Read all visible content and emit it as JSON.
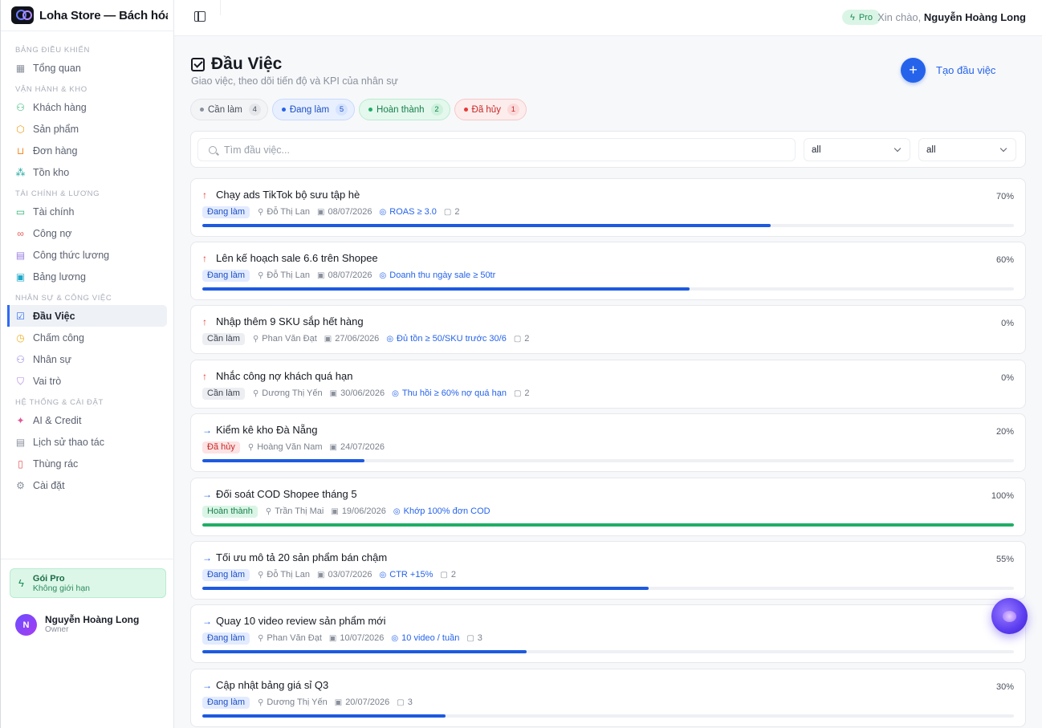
{
  "brand": {
    "title": "Loha Store — Bách hóa ..."
  },
  "sidebar": {
    "sections": [
      {
        "label": "BẢNG ĐIỀU KHIỂN",
        "items": [
          {
            "label": "Tổng quan",
            "icon": "grid-icon",
            "color": "#8a909c"
          }
        ]
      },
      {
        "label": "VẬN HÀNH & KHO",
        "items": [
          {
            "label": "Khách hàng",
            "icon": "users-icon",
            "color": "#2bb673"
          },
          {
            "label": "Sản phẩm",
            "icon": "box-icon",
            "color": "#f0a020"
          },
          {
            "label": "Đơn hàng",
            "icon": "cart-icon",
            "color": "#f08a20"
          },
          {
            "label": "Tồn kho",
            "icon": "boxes-icon",
            "color": "#20a8a0"
          }
        ]
      },
      {
        "label": "TÀI CHÍNH & LƯƠNG",
        "items": [
          {
            "label": "Tài chính",
            "icon": "wallet-icon",
            "color": "#2bb673"
          },
          {
            "label": "Công nợ",
            "icon": "handshake-icon",
            "color": "#e25a5a"
          },
          {
            "label": "Công thức lương",
            "icon": "calculator-icon",
            "color": "#9a7de0"
          },
          {
            "label": "Bảng lương",
            "icon": "card-icon",
            "color": "#20a8c8"
          }
        ]
      },
      {
        "label": "NHÂN SỰ & CÔNG VIỆC",
        "items": [
          {
            "label": "Đầu Việc",
            "icon": "checkbox-icon",
            "color": "#2f6bf5",
            "active": true
          },
          {
            "label": "Chấm công",
            "icon": "clock-icon",
            "color": "#f0b020"
          },
          {
            "label": "Nhân sự",
            "icon": "user-group-icon",
            "color": "#8a7de0"
          },
          {
            "label": "Vai trò",
            "icon": "shield-icon",
            "color": "#b07de0"
          }
        ]
      },
      {
        "label": "HỆ THỐNG & CÀI ĐẶT",
        "items": [
          {
            "label": "AI & Credit",
            "icon": "sparkles-icon",
            "color": "#e05a9a"
          },
          {
            "label": "Lịch sử thao tác",
            "icon": "history-icon",
            "color": "#8a909c"
          },
          {
            "label": "Thùng rác",
            "icon": "trash-icon",
            "color": "#e25a5a"
          },
          {
            "label": "Cài đặt",
            "icon": "gear-icon",
            "color": "#8a909c"
          }
        ]
      }
    ],
    "plan": {
      "title": "Gói Pro",
      "subtitle": "Không giới hạn"
    },
    "user": {
      "initial": "N",
      "name": "Nguyễn Hoàng Long",
      "role": "Owner"
    }
  },
  "topbar": {
    "plan_badge": "Pro",
    "greeting": "Xin chào,",
    "user_name": "Nguyễn Hoàng Long"
  },
  "page": {
    "title": "Đầu Việc",
    "subtitle": "Giao việc, theo dõi tiến độ và KPI của nhân sự",
    "create_label": "Tạo đầu việc"
  },
  "status_chips": [
    {
      "key": "todo",
      "label": "Cần làm",
      "count": "4"
    },
    {
      "key": "doing",
      "label": "Đang làm",
      "count": "5"
    },
    {
      "key": "done",
      "label": "Hoàn thành",
      "count": "2"
    },
    {
      "key": "cancel",
      "label": "Đã hủy",
      "count": "1"
    }
  ],
  "filters": {
    "search_placeholder": "Tìm đầu việc...",
    "select1": "all",
    "select2": "all"
  },
  "tasks": [
    {
      "title": "Chạy ads TikTok bộ sưu tập hè",
      "priority": "up",
      "status": "doing",
      "status_label": "Đang làm",
      "assignee": "Đỗ Thị Lan",
      "due": "08/07/2026",
      "kpi": "ROAS ≥ 3.0",
      "comments": "2",
      "progress": 70,
      "pct_label": "70%"
    },
    {
      "title": "Lên kế hoạch sale 6.6 trên Shopee",
      "priority": "up",
      "status": "doing",
      "status_label": "Đang làm",
      "assignee": "Đỗ Thị Lan",
      "due": "08/07/2026",
      "kpi": "Doanh thu ngày sale ≥ 50tr",
      "comments": "",
      "progress": 60,
      "pct_label": "60%"
    },
    {
      "title": "Nhập thêm 9 SKU sắp hết hàng",
      "priority": "up",
      "status": "todo",
      "status_label": "Cần làm",
      "assignee": "Phan Văn Đạt",
      "due": "27/06/2026",
      "kpi": "Đủ tồn ≥ 50/SKU trước 30/6",
      "comments": "2",
      "progress": 0,
      "pct_label": "0%"
    },
    {
      "title": "Nhắc công nợ khách quá hạn",
      "priority": "up",
      "status": "todo",
      "status_label": "Cần làm",
      "assignee": "Dương Thị Yến",
      "due": "30/06/2026",
      "kpi": "Thu hồi ≥ 60% nợ quá hạn",
      "comments": "2",
      "progress": 0,
      "pct_label": "0%"
    },
    {
      "title": "Kiểm kê kho Đà Nẵng",
      "priority": "right",
      "status": "cancel",
      "status_label": "Đã hủy",
      "assignee": "Hoàng Văn Nam",
      "due": "24/07/2026",
      "kpi": "",
      "comments": "",
      "progress": 20,
      "pct_label": "20%"
    },
    {
      "title": "Đối soát COD Shopee tháng 5",
      "priority": "right",
      "status": "done",
      "status_label": "Hoàn thành",
      "assignee": "Trần Thị Mai",
      "due": "19/06/2026",
      "kpi": "Khớp 100% đơn COD",
      "comments": "",
      "progress": 100,
      "pct_label": "100%"
    },
    {
      "title": "Tối ưu mô tả 20 sản phẩm bán chậm",
      "priority": "right",
      "status": "doing",
      "status_label": "Đang làm",
      "assignee": "Đỗ Thị Lan",
      "due": "03/07/2026",
      "kpi": "CTR +15%",
      "comments": "2",
      "progress": 55,
      "pct_label": "55%"
    },
    {
      "title": "Quay 10 video review sản phẩm mới",
      "priority": "right",
      "status": "doing",
      "status_label": "Đang làm",
      "assignee": "Phan Văn Đạt",
      "due": "10/07/2026",
      "kpi": "10 video / tuần",
      "comments": "3",
      "progress": 40,
      "pct_label": ""
    },
    {
      "title": "Cập nhật bảng giá sỉ Q3",
      "priority": "right",
      "status": "doing",
      "status_label": "Đang làm",
      "assignee": "Dương Thị Yến",
      "due": "20/07/2026",
      "kpi": "",
      "comments": "3",
      "progress": 30,
      "pct_label": "30%"
    }
  ]
}
